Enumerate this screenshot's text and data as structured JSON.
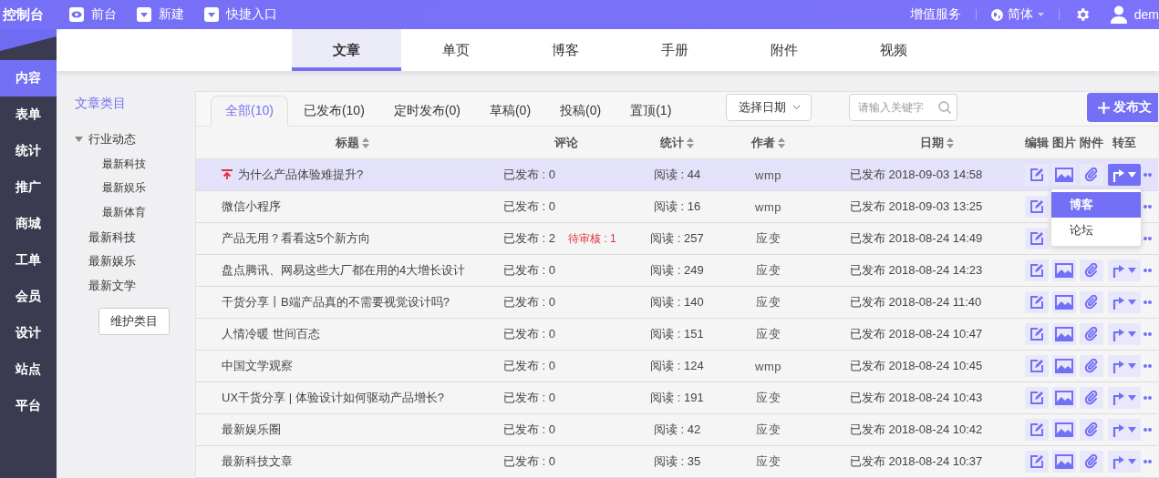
{
  "brand": "控制台",
  "top_links": [
    {
      "label": "前台",
      "kind": "preview"
    },
    {
      "label": "新建",
      "kind": "dropdown"
    },
    {
      "label": "快捷入口",
      "kind": "dropdown"
    }
  ],
  "top_right": {
    "service": "增值服务",
    "language": "简体",
    "user": "dem"
  },
  "sidebar": {
    "items": [
      {
        "label": "内容",
        "selected": true
      },
      {
        "label": "表单",
        "selected": false
      },
      {
        "label": "统计",
        "selected": false
      },
      {
        "label": "推广",
        "selected": false
      },
      {
        "label": "商城",
        "selected": false
      },
      {
        "label": "工单",
        "selected": false
      },
      {
        "label": "会员",
        "selected": false
      },
      {
        "label": "设计",
        "selected": false
      },
      {
        "label": "站点",
        "selected": false
      },
      {
        "label": "平台",
        "selected": false
      }
    ]
  },
  "section_tabs": [
    {
      "label": "文章",
      "selected": true
    },
    {
      "label": "单页",
      "selected": false
    },
    {
      "label": "博客",
      "selected": false
    },
    {
      "label": "手册",
      "selected": false
    },
    {
      "label": "附件",
      "selected": false
    },
    {
      "label": "视频",
      "selected": false
    }
  ],
  "categories": {
    "title": "文章类目",
    "tree": [
      {
        "label": "行业动态",
        "expanded": true,
        "children": [
          {
            "label": "最新科技"
          },
          {
            "label": "最新娱乐"
          },
          {
            "label": "最新体育"
          }
        ]
      },
      {
        "label": "最新科技"
      },
      {
        "label": "最新娱乐"
      },
      {
        "label": "最新文学"
      }
    ],
    "button": "维护类目"
  },
  "filter_tabs": [
    {
      "label": "全部(10)",
      "selected": true
    },
    {
      "label": "已发布(10)",
      "selected": false
    },
    {
      "label": "定时发布(0)",
      "selected": false
    },
    {
      "label": "草稿(0)",
      "selected": false
    },
    {
      "label": "投稿(0)",
      "selected": false
    },
    {
      "label": "置顶(1)",
      "selected": false
    }
  ],
  "date_picker": "选择日期",
  "search": {
    "placeholder": "请输入关键字"
  },
  "publish_button": "发布文",
  "table": {
    "columns": [
      {
        "label": "标题",
        "sortable": true
      },
      {
        "label": "评论",
        "sortable": false
      },
      {
        "label": "统计",
        "sortable": true
      },
      {
        "label": "作者",
        "sortable": true
      },
      {
        "label": "日期",
        "sortable": true
      },
      {
        "label": "编辑",
        "sortable": false
      },
      {
        "label": "图片",
        "sortable": false
      },
      {
        "label": "附件",
        "sortable": false
      },
      {
        "label": "转至",
        "sortable": false
      }
    ],
    "rows": [
      {
        "title": "为什么产品体验难提升?",
        "pinned": true,
        "selected": true,
        "comments": "已发布 : 0",
        "stats": "阅读 : 44",
        "author": "wmp",
        "date": "已发布 2018-09-03 14:58",
        "move_menu": [
          {
            "label": "博客",
            "selected": true
          },
          {
            "label": "论坛",
            "selected": false
          }
        ]
      },
      {
        "title": "微信小程序",
        "pinned": false,
        "selected": false,
        "comments": "已发布 : 0",
        "stats": "阅读 : 16",
        "author": "wmp",
        "date": "已发布 2018-09-03 13:25"
      },
      {
        "title": "产品无用？看看这5个新方向",
        "pinned": false,
        "selected": false,
        "comments": "已发布 : 2",
        "pending": "待审核 : 1",
        "stats": "阅读 : 257",
        "author": "应变",
        "date": "已发布 2018-08-24 14:49"
      },
      {
        "title": "盘点腾讯、网易这些大厂都在用的4大增长设计",
        "pinned": false,
        "selected": false,
        "comments": "已发布 : 0",
        "stats": "阅读 : 249",
        "author": "应变",
        "date": "已发布 2018-08-24 14:23"
      },
      {
        "title": "干货分享丨B端产品真的不需要视觉设计吗?",
        "pinned": false,
        "selected": false,
        "comments": "已发布 : 0",
        "stats": "阅读 : 140",
        "author": "应变",
        "date": "已发布 2018-08-24 11:40"
      },
      {
        "title": "人情冷暖 世间百态",
        "pinned": false,
        "selected": false,
        "comments": "已发布 : 0",
        "stats": "阅读 : 151",
        "author": "应变",
        "date": "已发布 2018-08-24 10:47"
      },
      {
        "title": "中国文学观察",
        "pinned": false,
        "selected": false,
        "comments": "已发布 : 0",
        "stats": "阅读 : 124",
        "author": "wmp",
        "date": "已发布 2018-08-24 10:45"
      },
      {
        "title": "UX干货分享 | 体验设计如何驱动产品增长?",
        "pinned": false,
        "selected": false,
        "comments": "已发布 : 0",
        "stats": "阅读 : 191",
        "author": "应变",
        "date": "已发布 2018-08-24 10:43"
      },
      {
        "title": "最新娱乐圈",
        "pinned": false,
        "selected": false,
        "comments": "已发布 : 0",
        "stats": "阅读 : 42",
        "author": "应变",
        "date": "已发布 2018-08-24 10:42"
      },
      {
        "title": "最新科技文章",
        "pinned": false,
        "selected": false,
        "comments": "已发布 : 0",
        "stats": "阅读 : 35",
        "author": "应变",
        "date": "已发布 2018-08-24 10:37"
      }
    ]
  }
}
